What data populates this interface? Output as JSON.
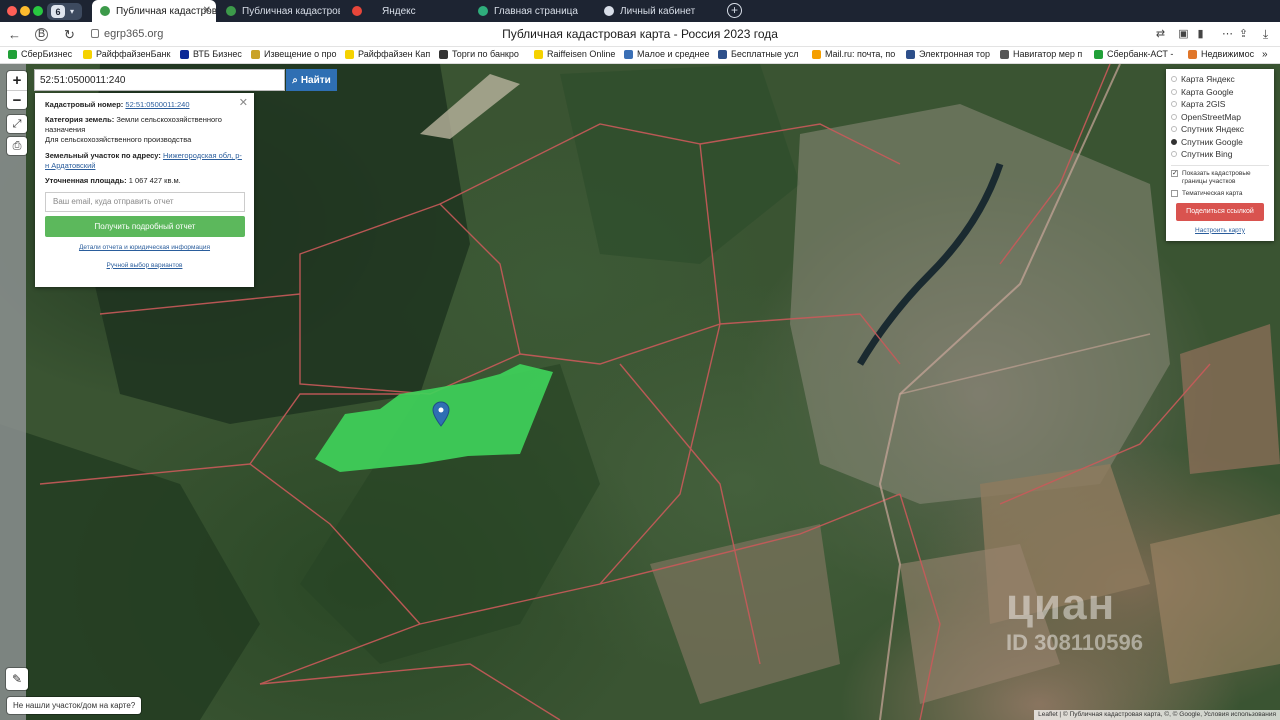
{
  "browser": {
    "profile_number": "6",
    "tabs": [
      {
        "label": "Публичная кадастрова",
        "active": true,
        "favicon_color": "#3c9a4a"
      },
      {
        "label": "Публичная кадастрова",
        "active": false,
        "favicon_color": "#3c9a4a"
      },
      {
        "label": "Яндекс",
        "active": false,
        "favicon_color": "#e8463a"
      },
      {
        "label": "Главная страница",
        "active": false,
        "favicon_color": "#2fae7c"
      },
      {
        "label": "Личный кабинет",
        "active": false,
        "favicon_color": "#d8dee8"
      }
    ],
    "url": "egrp365.org",
    "page_title": "Публичная кадастровая карта - Россия 2023 года",
    "bookmarks": [
      {
        "label": "СберБизнес",
        "color": "#21a038"
      },
      {
        "label": "РайффайзенБанк",
        "color": "#f5d200"
      },
      {
        "label": "ВТБ Бизнес",
        "color": "#0a2896"
      },
      {
        "label": "Извещение о про",
        "color": "#c9a227"
      },
      {
        "label": "Райффайзен Кап",
        "color": "#f5d200"
      },
      {
        "label": "Торги по банкро",
        "color": "#333333"
      },
      {
        "label": "Raiffeisen Online",
        "color": "#f5d200"
      },
      {
        "label": "Малое и среднее",
        "color": "#3a6fb5"
      },
      {
        "label": "Бесплатные усл",
        "color": "#2d4f8a"
      },
      {
        "label": "Mail.ru: почта, по",
        "color": "#f59f00"
      },
      {
        "label": "Электронная тор",
        "color": "#2d4f8a"
      },
      {
        "label": "Навигатор мер п",
        "color": "#555555"
      },
      {
        "label": "Сбербанк-АСТ -",
        "color": "#21a038"
      },
      {
        "label": "Недвижимос",
        "color": "#e0762a"
      }
    ]
  },
  "search": {
    "value": "52:51:0500011:240",
    "button_label": "Найти"
  },
  "info": {
    "cadastral_label": "Кадастровый номер:",
    "cadastral_value": "52:51:0500011:240",
    "category_label": "Категория земель:",
    "category_value": "Земли сельскохозяйственного назначения",
    "category_use": "Для сельскохозяйственного производства",
    "address_label": "Земельный участок по адресу:",
    "address_value": "Нижегородская обл, р-н Ардатовский",
    "area_label": "Уточненная площадь:",
    "area_value": "1 067 427 кв.м.",
    "email_placeholder": "Ваш email, куда отправить отчет",
    "report_button": "Получить подробный отчет",
    "details_link": "Детали отчета и юридическая информация",
    "manual_link": "Ручной выбор вариантов"
  },
  "layers": {
    "options": [
      {
        "label": "Карта Яндекс",
        "selected": false
      },
      {
        "label": "Карта Google",
        "selected": false
      },
      {
        "label": "Карта 2GIS",
        "selected": false
      },
      {
        "label": "OpenStreetMap",
        "selected": false
      },
      {
        "label": "Спутник Яндекс",
        "selected": false
      },
      {
        "label": "Спутник Google",
        "selected": true
      },
      {
        "label": "Спутник Bing",
        "selected": false
      }
    ],
    "show_borders": "Показать кадастровые границы участков",
    "thematic": "Тематическая карта",
    "share_button": "Поделиться ссылкой",
    "setup_link": "Настроить карту"
  },
  "map": {
    "not_found": "Не нашли участок/дом на карте?",
    "attribution": "Leaflet | © Публичная кадастровая карта, ©, © Google, Условия использования",
    "watermark_brand": "циан",
    "watermark_id": "ID 308110596",
    "parcel_color": "#3fd15a",
    "border_color": "#c95a5a"
  }
}
